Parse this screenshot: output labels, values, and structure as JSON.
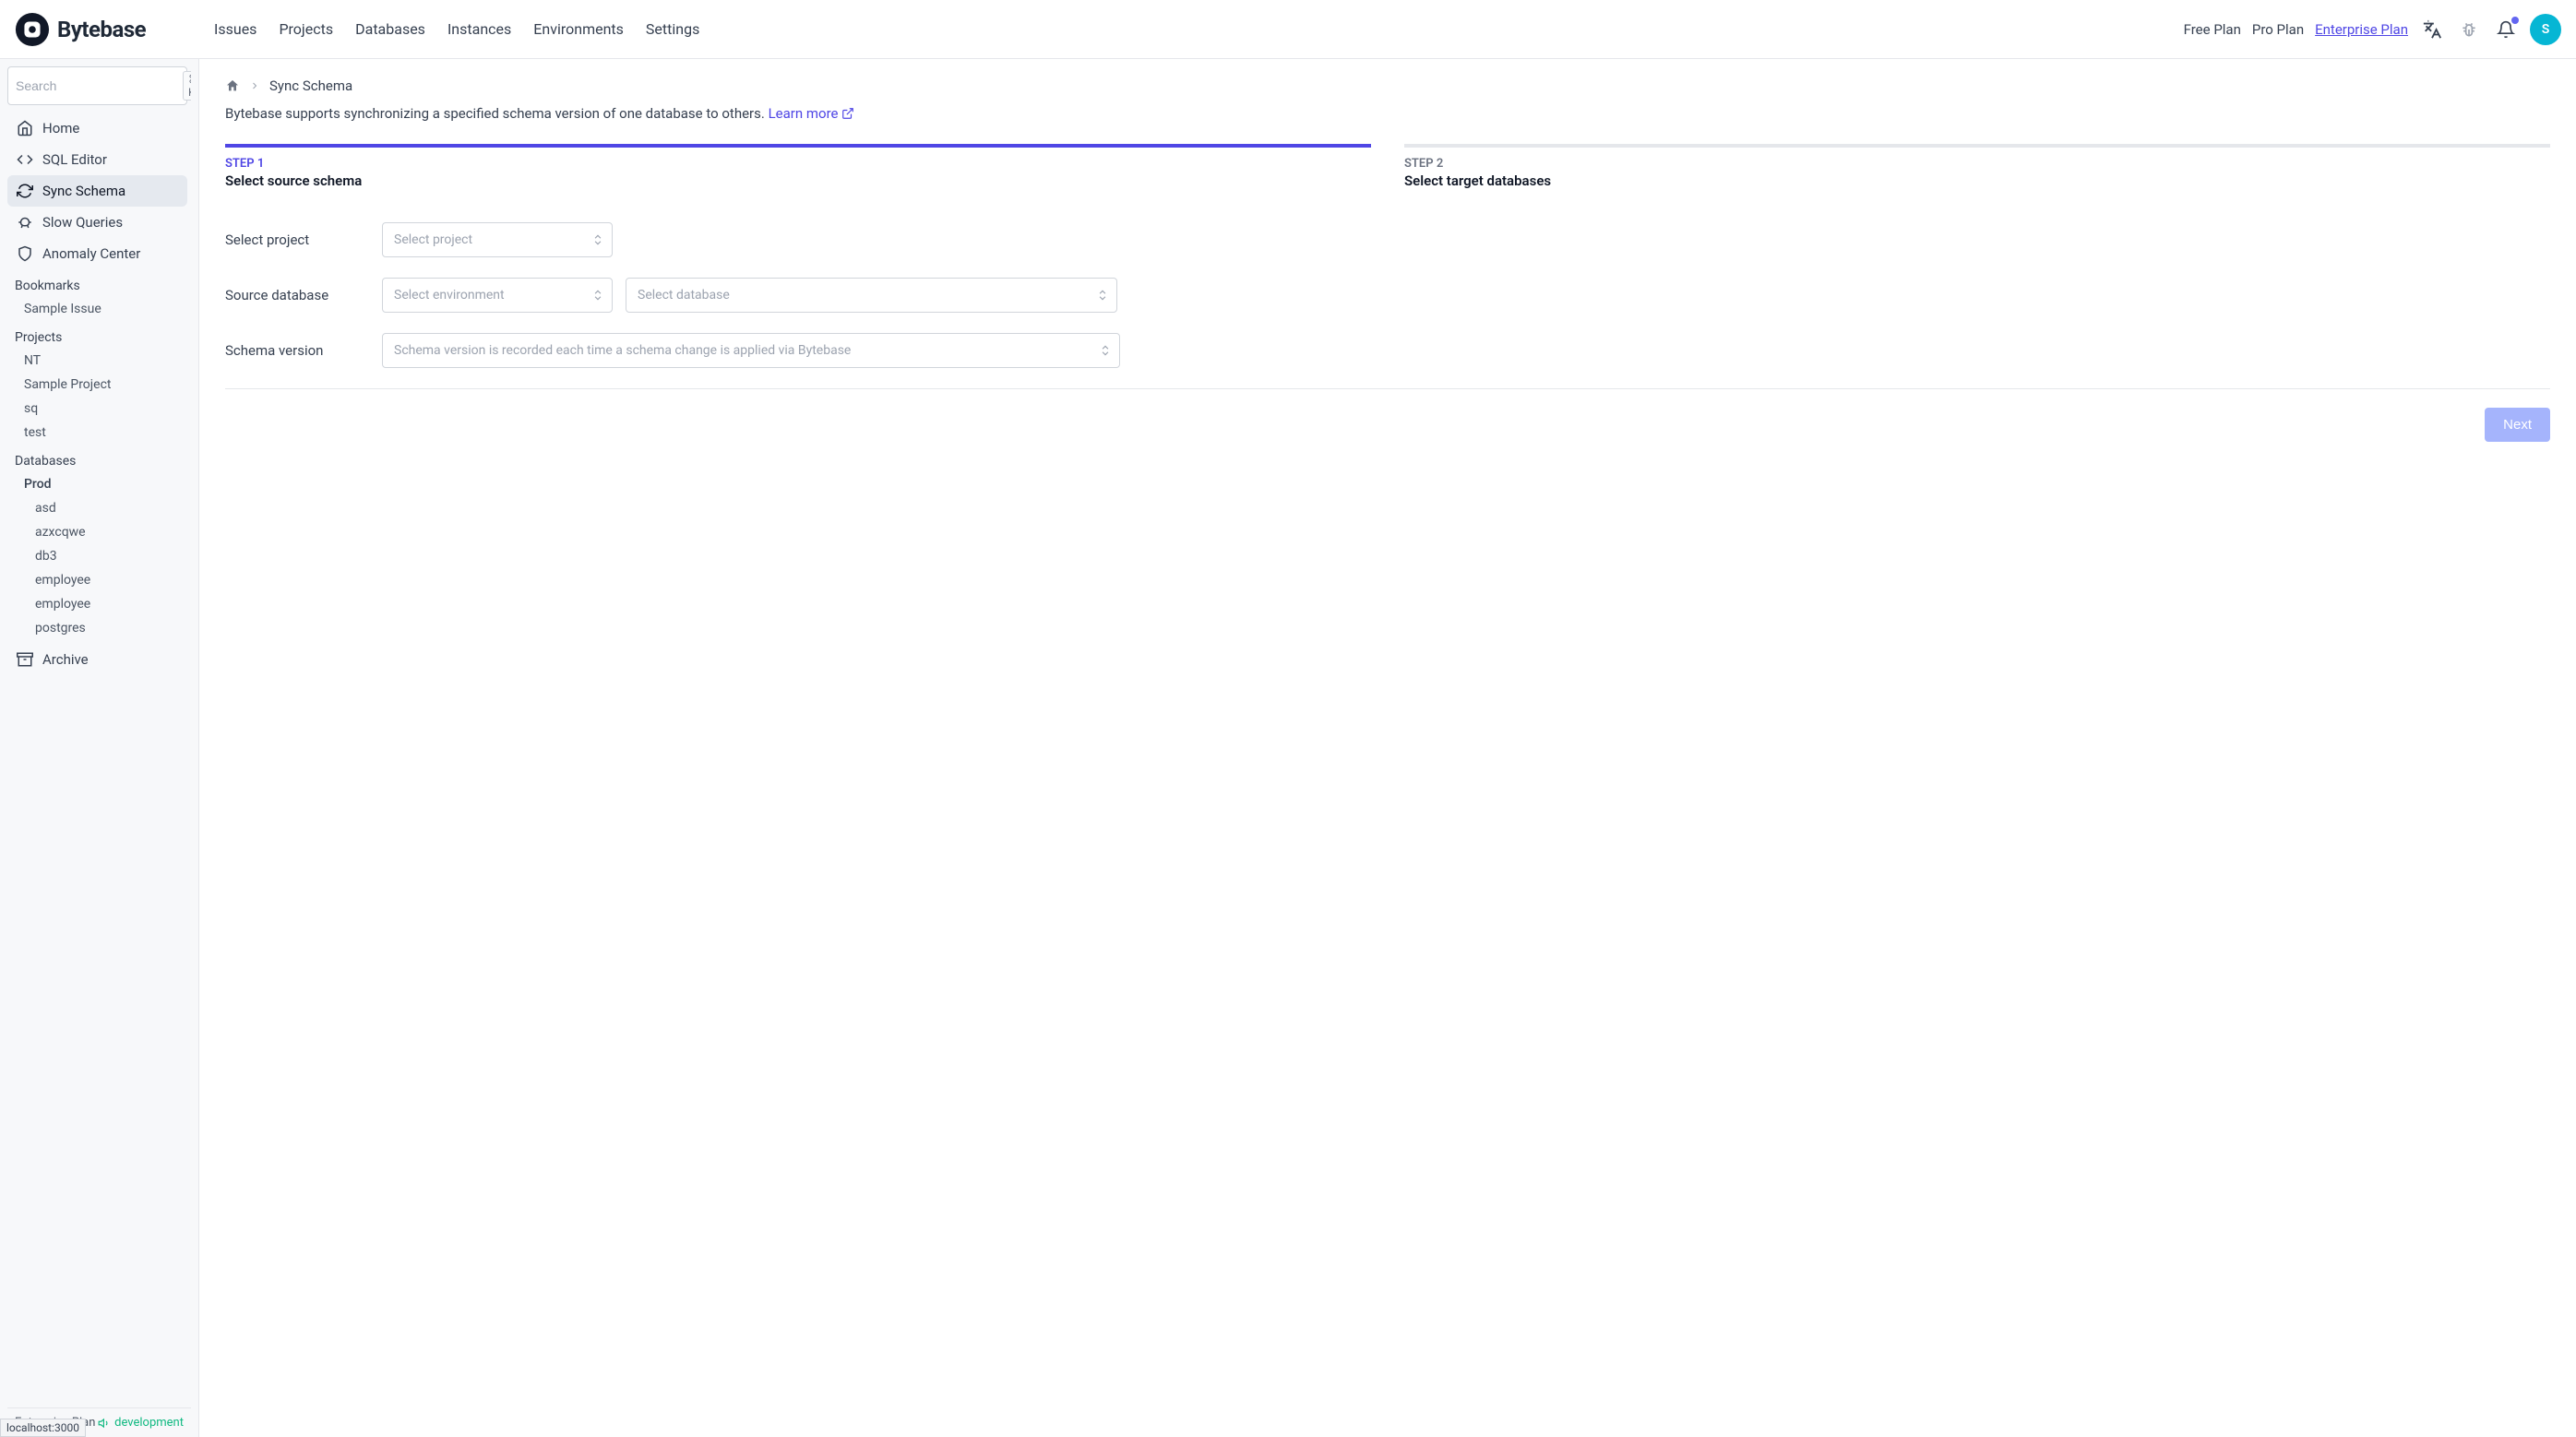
{
  "brand": "Bytebase",
  "topnav": {
    "items": [
      "Issues",
      "Projects",
      "Databases",
      "Instances",
      "Environments",
      "Settings"
    ]
  },
  "plans": {
    "free": "Free Plan",
    "pro": "Pro Plan",
    "enterprise": "Enterprise Plan"
  },
  "avatar_initial": "S",
  "search": {
    "placeholder": "Search",
    "shortcut": "⌘ K"
  },
  "sidebar": {
    "nav": [
      {
        "icon": "home",
        "label": "Home"
      },
      {
        "icon": "sql",
        "label": "SQL Editor"
      },
      {
        "icon": "sync",
        "label": "Sync Schema",
        "active": true
      },
      {
        "icon": "slow",
        "label": "Slow Queries"
      },
      {
        "icon": "shield",
        "label": "Anomaly Center"
      }
    ],
    "bookmarks_title": "Bookmarks",
    "bookmarks": [
      "Sample Issue"
    ],
    "projects_title": "Projects",
    "projects": [
      "NT",
      "Sample Project",
      "sq",
      "test"
    ],
    "databases_title": "Databases",
    "db_env": "Prod",
    "databases": [
      "asd",
      "azxcqwe",
      "db3",
      "employee",
      "employee",
      "postgres"
    ],
    "archive": {
      "icon": "archive",
      "label": "Archive"
    }
  },
  "footer": {
    "plan": "Enterprise Plan",
    "dev": "development"
  },
  "breadcrumb": {
    "current": "Sync Schema"
  },
  "page": {
    "description": "Bytebase supports synchronizing a specified schema version of one database to others.",
    "learn_more": "Learn more"
  },
  "steps": [
    {
      "num": "STEP 1",
      "title": "Select source schema",
      "active": true
    },
    {
      "num": "STEP 2",
      "title": "Select target databases",
      "active": false
    }
  ],
  "form": {
    "project_label": "Select project",
    "project_placeholder": "Select project",
    "source_label": "Source database",
    "env_placeholder": "Select environment",
    "db_placeholder": "Select database",
    "version_label": "Schema version",
    "version_placeholder": "Schema version is recorded each time a schema change is applied via Bytebase"
  },
  "actions": {
    "next": "Next"
  },
  "status_bar": "localhost:3000"
}
